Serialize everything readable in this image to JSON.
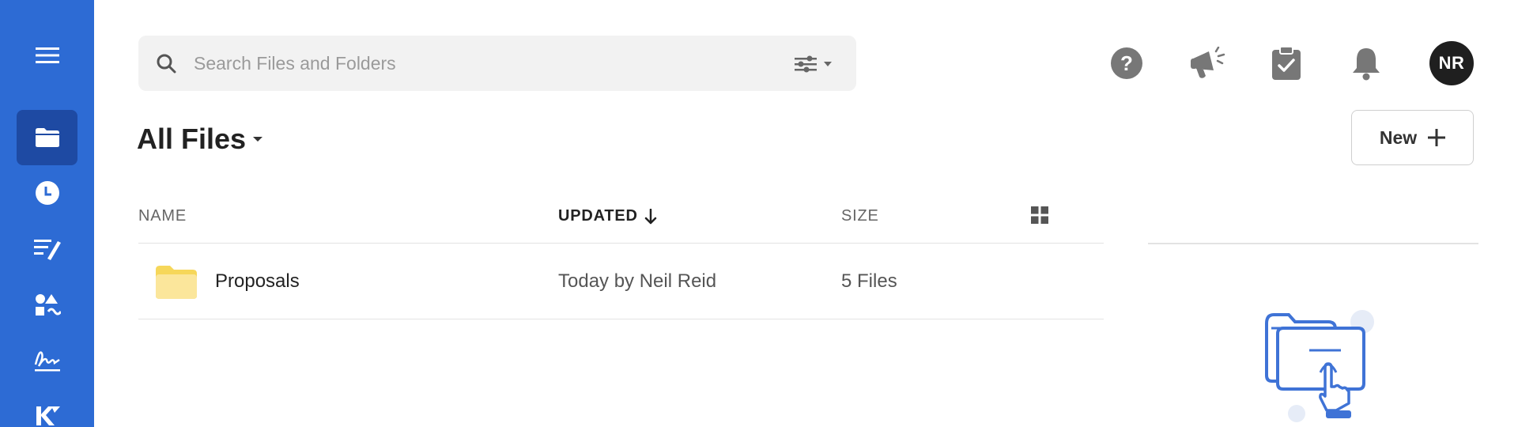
{
  "sidebar": {
    "items": [
      {
        "name": "menu",
        "icon": "hamburger-icon"
      },
      {
        "name": "files",
        "icon": "folder-icon",
        "active": true
      },
      {
        "name": "recent",
        "icon": "clock-icon"
      },
      {
        "name": "edit",
        "icon": "edit-list-icon"
      },
      {
        "name": "apps",
        "icon": "shapes-icon"
      },
      {
        "name": "signature",
        "icon": "signature-icon"
      },
      {
        "name": "brand",
        "icon": "brand-logo-icon"
      }
    ],
    "color": "#2d6bd4",
    "active_color": "#1e4aa3"
  },
  "search": {
    "placeholder": "Search Files and Folders",
    "value": ""
  },
  "header": {
    "icons": [
      "help-icon",
      "announcement-icon",
      "tasks-clipboard-icon",
      "bell-icon"
    ],
    "avatar_initials": "NR"
  },
  "page": {
    "title": "All Files",
    "new_button_label": "New"
  },
  "table": {
    "columns": {
      "name": "NAME",
      "updated": "UPDATED",
      "size": "SIZE"
    },
    "sort_column": "updated",
    "sort_direction": "descending",
    "rows": [
      {
        "icon": "folder-icon",
        "name": "Proposals",
        "updated": "Today by Neil Reid",
        "size": "5 Files"
      }
    ]
  },
  "colors": {
    "accent": "#2d6bd4",
    "folder": "#f6d75a",
    "icon_gray": "#7a7a7a",
    "illustration": "#3f73d6"
  }
}
